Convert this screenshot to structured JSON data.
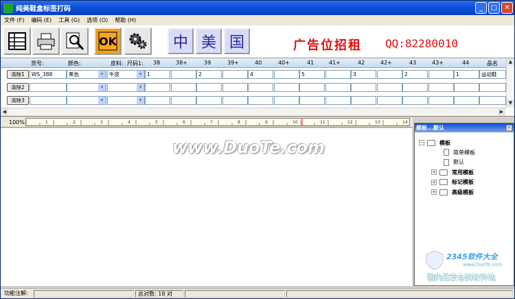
{
  "title": "纯美鞋盒标签打码",
  "menu": [
    "文件 (F)",
    "编码 (E)",
    "工具 (G)",
    "选项 (O)",
    "帮助 (H)"
  ],
  "toolbar": {
    "lang_buttons": [
      "中",
      "美",
      "国"
    ],
    "ad_text": "广告位招租",
    "ad_qq": "QQ:82280010"
  },
  "grid": {
    "headers": [
      "货号:",
      "颜色:",
      "皮料:",
      "尺码1:",
      "38",
      "38+",
      "39",
      "39+",
      "40",
      "40+",
      "41",
      "41+",
      "42",
      "42+",
      "43",
      "43+",
      "44",
      "品名"
    ],
    "clear_label": "清除",
    "rows": [
      {
        "label": "清除1",
        "item": "WS_388",
        "color": "黑色",
        "leather": "牛皮",
        "sizes": [
          "1",
          "",
          "2",
          "",
          "4",
          "",
          "5",
          "",
          "3",
          "",
          "2",
          "",
          "1"
        ],
        "name": "运动鞋"
      },
      {
        "label": "清除2",
        "item": "",
        "color": "",
        "leather": "",
        "sizes": [
          "",
          "",
          "",
          "",
          "",
          "",
          "",
          "",
          "",
          "",
          "",
          "",
          ""
        ],
        "name": ""
      },
      {
        "label": "清除3",
        "item": "",
        "color": "",
        "leather": "",
        "sizes": [
          "",
          "",
          "",
          "",
          "",
          "",
          "",
          "",
          "",
          "",
          "",
          "",
          ""
        ],
        "name": ""
      }
    ]
  },
  "ruler": {
    "zoom": "100%"
  },
  "watermark": "www.DuoTe.com",
  "panel": {
    "title": "模板...默认",
    "root": "模板",
    "items": [
      {
        "label": "简单模板",
        "type": "doc"
      },
      {
        "label": "默认",
        "type": "doc"
      },
      {
        "label": "常用模板",
        "type": "folder"
      },
      {
        "label": "标记模板",
        "type": "folder"
      },
      {
        "label": "高级模板",
        "type": "folder"
      }
    ]
  },
  "watermark2": {
    "brand": "2345软件大全",
    "url": "www.DuoTe.com",
    "slogan": "国内最安全的软件站"
  },
  "status": {
    "func_label": "功能注解:",
    "total": "总对数: 18 对"
  }
}
